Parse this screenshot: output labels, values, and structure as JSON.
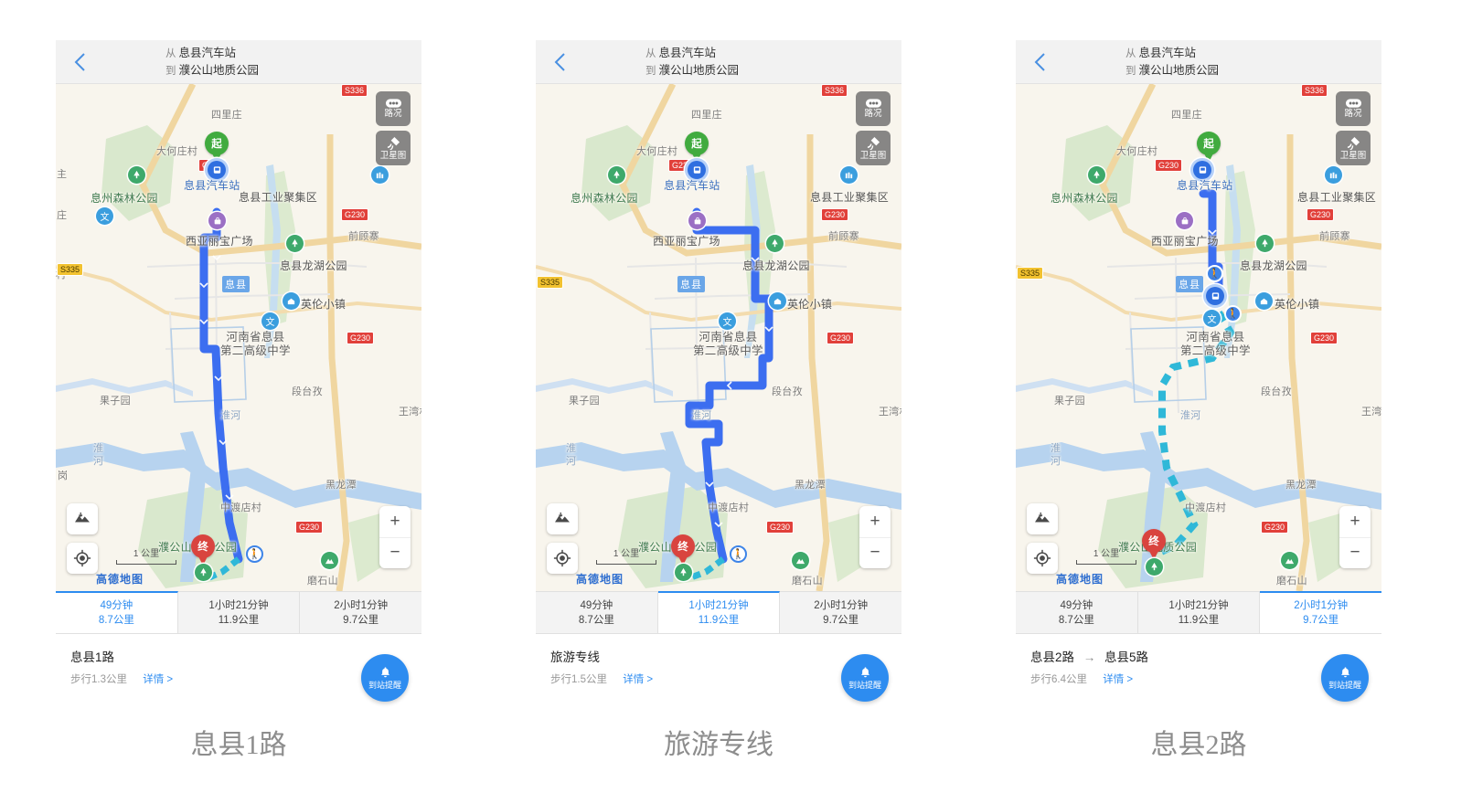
{
  "header": {
    "back_icon": "chevron-left-icon",
    "from_prefix": "从",
    "from_value": "息县汽车站",
    "to_prefix": "到",
    "to_value": "濮公山地质公园"
  },
  "map_controls": {
    "traffic_label": "路况",
    "traffic_icon": "traffic-dots-icon",
    "satellite_label": "卫星图",
    "satellite_icon": "satellite-icon",
    "layers_icon": "map-layers-icon",
    "locate_icon": "locate-crosshair-icon",
    "zoom_in": "+",
    "zoom_out": "−",
    "scale_text": "1 公里",
    "brand": "高德地图"
  },
  "markers": {
    "start_label": "起",
    "end_label": "终",
    "bus_stop_icon": "bus-stop-icon",
    "walk_icon": "walking-person-icon"
  },
  "map_labels": {
    "places": [
      "四里庄",
      "大何庄村",
      "息州森林公园",
      "息县工业聚集区",
      "前顾寨",
      "西亚丽宝广场",
      "息县龙湖公园",
      "英伦小镇",
      "河南省息县",
      "第二高级中学",
      "段台孜",
      "果子园",
      "淮河",
      "黑龙潭",
      "中渡店村",
      "濮公山地质公园",
      "磨石山",
      "息县汽车站",
      "岗",
      "息县",
      "王湾村",
      "庄",
      "村",
      "主"
    ],
    "road_shields": [
      "S336",
      "G230",
      "S335",
      "G230",
      "G230"
    ]
  },
  "tabs": [
    {
      "time": "49分钟",
      "distance": "8.7公里"
    },
    {
      "time": "1小时21分钟",
      "distance": "11.9公里"
    },
    {
      "time": "2小时1分钟",
      "distance": "9.7公里"
    }
  ],
  "panels": [
    {
      "active_tab": 0,
      "route_name": "息县1路",
      "route_name_2": "",
      "arrow": "",
      "walk_text": "步行1.3公里",
      "detail_label": "详情 >",
      "fab_label": "到站提醒",
      "fab_icon": "bell-icon",
      "caption": "息县1路"
    },
    {
      "active_tab": 1,
      "route_name": "旅游专线",
      "route_name_2": "",
      "arrow": "",
      "walk_text": "步行1.5公里",
      "detail_label": "详情 >",
      "fab_label": "到站提醒",
      "fab_icon": "bell-icon",
      "caption": "旅游专线"
    },
    {
      "active_tab": 2,
      "route_name": "息县2路",
      "route_name_2": "息县5路",
      "arrow": "→",
      "walk_text": "步行6.4公里",
      "detail_label": "详情 >",
      "fab_label": "到站提醒",
      "fab_icon": "bell-icon",
      "caption": "息县2路"
    }
  ],
  "colors": {
    "route_blue": "#3c6ef0",
    "walk_cyan": "#2fb8d8",
    "accent": "#2d8cf0",
    "start_green": "#41ab3f",
    "end_red": "#d9443f"
  }
}
